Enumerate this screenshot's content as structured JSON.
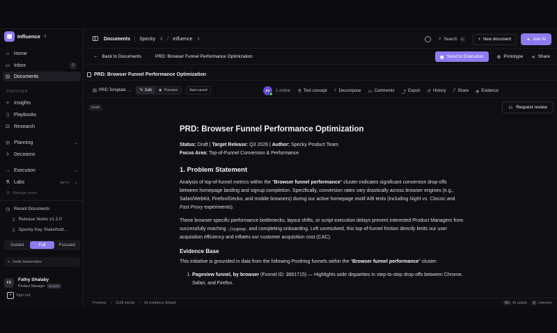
{
  "sidebar": {
    "workspace": "Influence",
    "nav_main": [
      {
        "label": "Home",
        "icon": "home-icon"
      },
      {
        "label": "Inbox",
        "icon": "inbox-icon",
        "count": "0"
      },
      {
        "label": "Documents",
        "icon": "documents-icon"
      }
    ],
    "discover_label": "DISCOVER",
    "nav_discover": [
      {
        "label": "Insights",
        "icon": "lightbulb-icon"
      },
      {
        "label": "Playbooks",
        "icon": "book-icon"
      },
      {
        "label": "Research",
        "icon": "research-icon"
      },
      {
        "label": "Planning",
        "icon": "planning-icon"
      },
      {
        "label": "Decisions",
        "icon": "decision-icon"
      },
      {
        "label": "Execution",
        "icon": "execution-icon"
      },
      {
        "label": "Labs",
        "icon": "flask-icon",
        "badge": "BETA"
      }
    ],
    "manage_views": "Manage views",
    "recent_label": "Recent Documents",
    "recent": [
      "Release Notes v1.2.0",
      "Specky Key Stakehold..."
    ],
    "modes": [
      "Guided",
      "Full",
      "Focused"
    ],
    "active_mode": "Full",
    "invite": "Invite teammates",
    "user": {
      "initials": "FS",
      "name": "Fathy Shalaby",
      "role": "Product Manager",
      "badge": "SCALE"
    },
    "signout": "Sign out"
  },
  "topbar": {
    "crumb1": "Documents",
    "crumb2": "Specky",
    "crumb3": "Influence",
    "search": "Search",
    "search_kbd": "K",
    "new_document": "New document",
    "ask_ai": "Ask AI"
  },
  "docbar": {
    "back": "Back to Documents",
    "title": "PRD: Browser Funnel Performance Optimization",
    "send": "Send to Execution",
    "prototype": "Prototype",
    "share": "Share"
  },
  "tab_title": "PRD: Browser Funnel Performance Optimization",
  "toolbar": {
    "template": "PRD Template",
    "edit": "Edit",
    "preview": "Preview",
    "autosaved": "Auto-saved",
    "avatar": "FS",
    "online": "1 online",
    "items": [
      "Test concept",
      "Decompose",
      "Comments",
      "Export",
      "History",
      "Share",
      "Evidence"
    ]
  },
  "draft": "Draft",
  "request_review": "Request review",
  "doc": {
    "h1": "PRD: Browser Funnel Performance Optimization",
    "status_label": "Status:",
    "status": "Draft",
    "release_label": "Target Release:",
    "release": "Q3 2026",
    "author_label": "Author:",
    "author": "Specky Product Team",
    "focus_label": "Focus Area:",
    "focus": "Top-of-Funnel Conversion & Performance",
    "h2_1": "1. Problem Statement",
    "p1_a": "Analysis of top-of-funnel metrics within the \"",
    "p1_b": "Browser funnel performance",
    "p1_c": "\" cluster indicates significant conversion drop-offs between homepage landing and signup completion. Specifically, conversion rates vary drastically across browser engines (e.g., Safari/WebKit, Firefox/Gecko, and mobile browsers) during our active homepage motif A/B tests (including ",
    "p1_d": "Night vs. Classic",
    "p1_e": " and ",
    "p1_f": "Fast Proxy",
    "p1_g": " experiments).",
    "p2_a": "These browser-specific performance bottlenecks, layout shifts, or script execution delays prevent interested Product Managers from successfully reaching ",
    "p2_code": "/signup",
    "p2_b": " and completing onboarding. Left unresolved, this top-of-funnel friction directly limits our user acquisition efficiency and inflates our customer acquisition cost (CAC).",
    "h3_1": "Evidence Base",
    "p3_a": "This initiative is grounded in data from the following PostHog funnels within the \"",
    "p3_b": "Browser funnel performance",
    "p3_c": "\" cluster:",
    "li1_a": "Pageview funnel, by browser",
    "li1_b": " (Funnel ID: 3661715) — Highlights wide disparities in step-to-step drop-offs between Chrome, Safari, and Firefox."
  },
  "statusbar": {
    "mode": "Preview",
    "words": "1128 words",
    "evidence": "14 evidence linked",
    "ai_kbd": "⌘K",
    "ai": "AI assist",
    "mention_kbd": "@",
    "mention": "mention"
  }
}
